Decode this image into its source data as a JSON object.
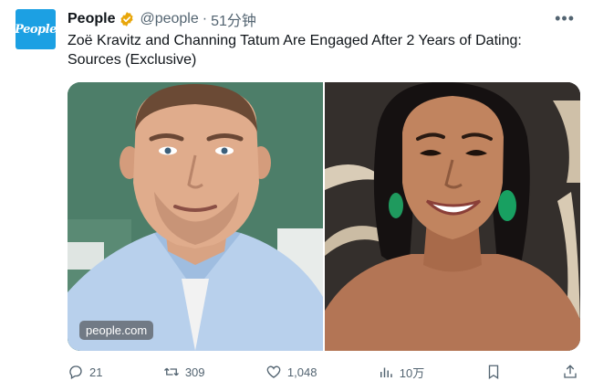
{
  "avatar": {
    "text": "People",
    "color": "#1ca0e3"
  },
  "author": {
    "name": "People",
    "handle": "@people",
    "separator": "·",
    "time": "51分钟",
    "verified_icon": "gold-verified-badge-icon",
    "verified_color": "#e8a60a"
  },
  "more_icon": "ellipsis-icon",
  "tweet": {
    "text": "Zoë Kravitz and Channing Tatum Are Engaged After 2 Years of Dating: Sources (Exclusive)"
  },
  "media": {
    "watermark": "people.com"
  },
  "actions": {
    "reply": {
      "icon": "reply-icon",
      "count": "21"
    },
    "retweet": {
      "icon": "retweet-icon",
      "count": "309"
    },
    "like": {
      "icon": "heart-icon",
      "count": "1,048"
    },
    "views": {
      "icon": "views-icon",
      "count": "10万"
    },
    "bookmark": {
      "icon": "bookmark-icon"
    },
    "share": {
      "icon": "share-icon"
    }
  }
}
